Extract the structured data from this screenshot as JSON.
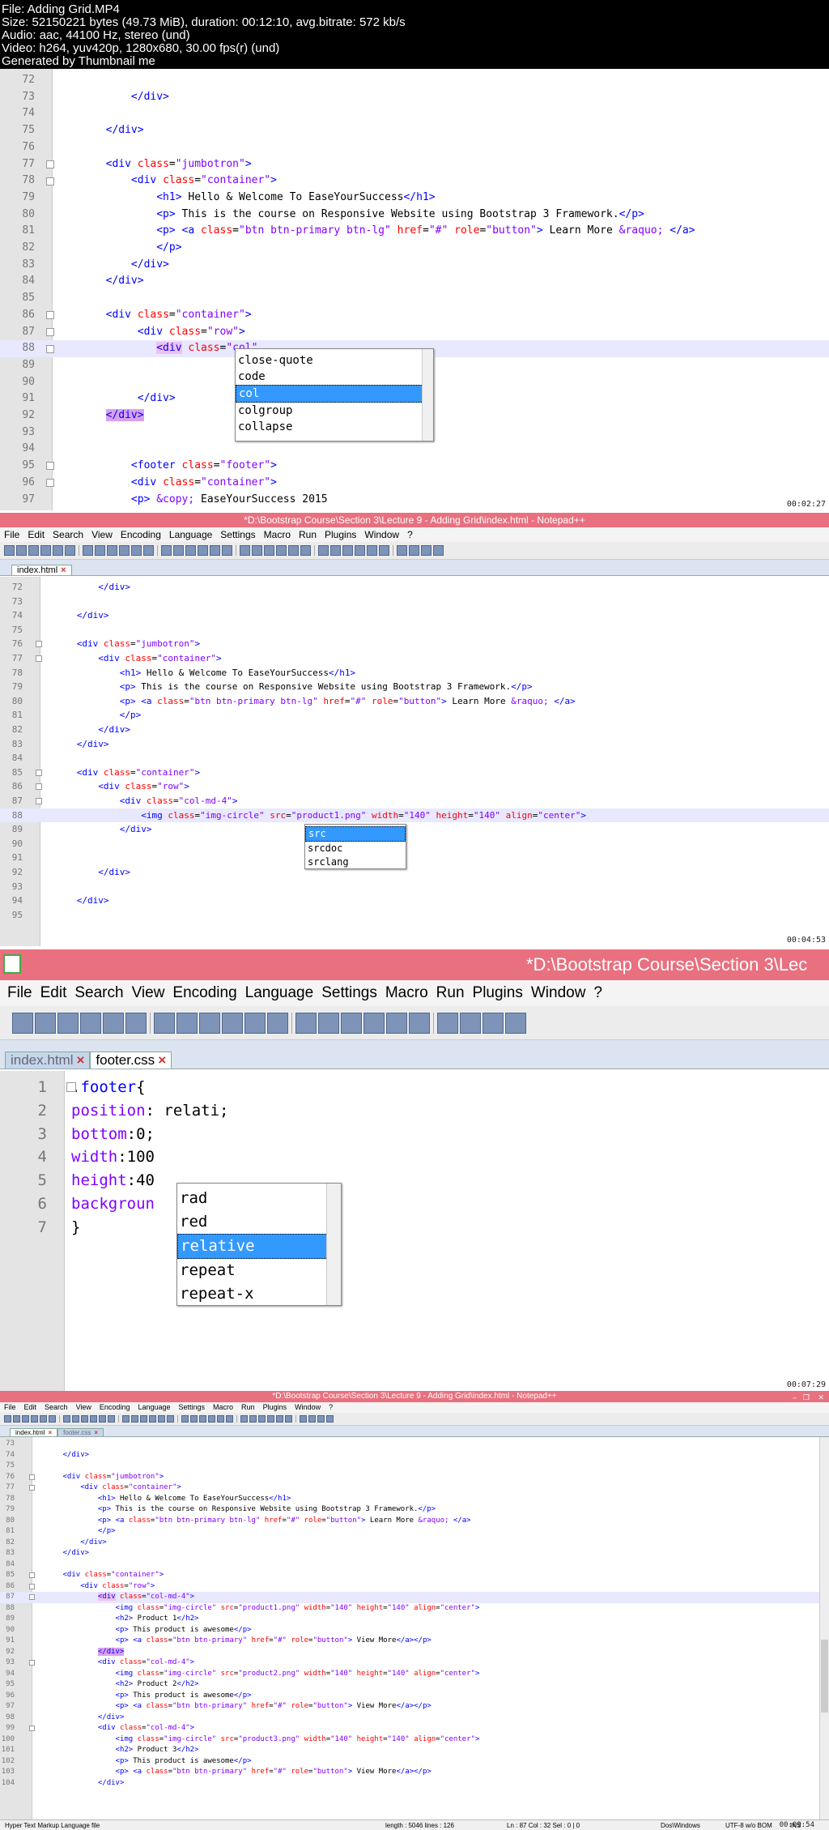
{
  "header": {
    "lines": [
      "File: Adding Grid.MP4",
      "Size: 52150221 bytes (49.73 MiB), duration: 00:12:10, avg.bitrate: 572 kb/s",
      "Audio: aac, 44100 Hz, stereo (und)",
      "Video: h264, yuv420p, 1280x680, 30.00 fps(r) (und)",
      "Generated by Thumbnail me"
    ]
  },
  "panel1": {
    "timestamp": "00:02:27",
    "lines": [
      {
        "n": "72",
        "html": ""
      },
      {
        "n": "73",
        "html": "            <span class='t'>&lt;/div&gt;</span>"
      },
      {
        "n": "74",
        "html": ""
      },
      {
        "n": "75",
        "html": "        <span class='t'>&lt;/div&gt;</span>"
      },
      {
        "n": "76",
        "html": ""
      },
      {
        "n": "77",
        "html": "        <span class='t'>&lt;div</span> <span class='a'>class</span>=<span class='v'>\"jumbotron\"</span><span class='t'>&gt;</span>"
      },
      {
        "n": "78",
        "html": "            <span class='t'>&lt;div</span> <span class='a'>class</span>=<span class='v'>\"container\"</span><span class='t'>&gt;</span>"
      },
      {
        "n": "79",
        "html": "                <span class='t'>&lt;h1&gt;</span> Hello &amp; Welcome To EaseYourSuccess<span class='t'>&lt;/h1&gt;</span>"
      },
      {
        "n": "80",
        "html": "                <span class='t'>&lt;p&gt;</span> This is the course on Responsive Website using Bootstrap 3 Framework.<span class='t'>&lt;/p&gt;</span>"
      },
      {
        "n": "81",
        "html": "                <span class='t'>&lt;p&gt;</span> <span class='t'>&lt;a</span> <span class='a'>class</span>=<span class='v'>\"btn btn-primary btn-lg\"</span> <span class='a'>href</span>=<span class='v'>\"#\"</span> <span class='a'>role</span>=<span class='v'>\"button\"</span><span class='t'>&gt;</span> Learn More <span class='v'>&amp;raquo;</span> <span class='t'>&lt;/a&gt;</span>"
      },
      {
        "n": "82",
        "html": "                <span class='t'>&lt;/p&gt;</span>"
      },
      {
        "n": "83",
        "html": "            <span class='t'>&lt;/div&gt;</span>"
      },
      {
        "n": "84",
        "html": "        <span class='t'>&lt;/div&gt;</span>"
      },
      {
        "n": "85",
        "html": ""
      },
      {
        "n": "86",
        "html": "        <span class='t'>&lt;div</span> <span class='a'>class</span>=<span class='v'>\"container\"</span><span class='t'>&gt;</span>"
      },
      {
        "n": "87",
        "html": "             <span class='t'>&lt;div</span> <span class='a'>class</span>=<span class='v'>\"row\"</span><span class='t'>&gt;</span>"
      },
      {
        "n": "88",
        "html": "                <span class='t' style='background:#f0c0f0'>&lt;div</span> <span class='a'>class</span>=<span class='v'>\"col\"</span>"
      },
      {
        "n": "89",
        "html": ""
      },
      {
        "n": "90",
        "html": ""
      },
      {
        "n": "91",
        "html": "             <span class='t'>&lt;/div&gt;</span>"
      },
      {
        "n": "92",
        "html": "        <span class='t' style='background:#d9a0f0'>&lt;/div&gt;</span>"
      },
      {
        "n": "93",
        "html": ""
      },
      {
        "n": "94",
        "html": ""
      },
      {
        "n": "95",
        "html": "            <span class='t'>&lt;footer</span> <span class='a'>class</span>=<span class='v'>\"footer\"</span><span class='t'>&gt;</span>"
      },
      {
        "n": "96",
        "html": "            <span class='t'>&lt;div</span> <span class='a'>class</span>=<span class='v'>\"container\"</span><span class='t'>&gt;</span>"
      },
      {
        "n": "97",
        "html": "            <span class='t'>&lt;p&gt;</span> <span class='v'>&amp;copy;</span> EaseYourSuccess 2015"
      }
    ],
    "autocomplete": [
      "close-quote",
      "code",
      "col",
      "colgroup",
      "collapse"
    ],
    "selected": 2
  },
  "panel2": {
    "timestamp": "00:04:53",
    "title": "*D:\\Bootstrap Course\\Section 3\\Lecture 9 - Adding Grid\\index.html - Notepad++",
    "menu": [
      "File",
      "Edit",
      "Search",
      "View",
      "Encoding",
      "Language",
      "Settings",
      "Macro",
      "Run",
      "Plugins",
      "Window",
      "?"
    ],
    "tabs": [
      {
        "label": "index.html",
        "active": true
      }
    ],
    "lines": [
      {
        "n": "72",
        "html": "          <span class='t'>&lt;/div&gt;</span>"
      },
      {
        "n": "73",
        "html": ""
      },
      {
        "n": "74",
        "html": "      <span class='t'>&lt;/div&gt;</span>"
      },
      {
        "n": "75",
        "html": ""
      },
      {
        "n": "76",
        "html": "      <span class='t'>&lt;div</span> <span class='a'>class</span>=<span class='v'>\"jumbotron\"</span><span class='t'>&gt;</span>"
      },
      {
        "n": "77",
        "html": "          <span class='t'>&lt;div</span> <span class='a'>class</span>=<span class='v'>\"container\"</span><span class='t'>&gt;</span>"
      },
      {
        "n": "78",
        "html": "              <span class='t'>&lt;h1&gt;</span> Hello &amp; Welcome To EaseYourSuccess<span class='t'>&lt;/h1&gt;</span>"
      },
      {
        "n": "79",
        "html": "              <span class='t'>&lt;p&gt;</span> This is the course on Responsive Website using Bootstrap 3 Framework.<span class='t'>&lt;/p&gt;</span>"
      },
      {
        "n": "80",
        "html": "              <span class='t'>&lt;p&gt;</span> <span class='t'>&lt;a</span> <span class='a'>class</span>=<span class='v'>\"btn btn-primary btn-lg\"</span> <span class='a'>href</span>=<span class='v'>\"#\"</span> <span class='a'>role</span>=<span class='v'>\"button\"</span><span class='t'>&gt;</span> Learn More <span class='v'>&amp;raquo;</span> <span class='t'>&lt;/a&gt;</span>"
      },
      {
        "n": "81",
        "html": "              <span class='t'>&lt;/p&gt;</span>"
      },
      {
        "n": "82",
        "html": "          <span class='t'>&lt;/div&gt;</span>"
      },
      {
        "n": "83",
        "html": "      <span class='t'>&lt;/div&gt;</span>"
      },
      {
        "n": "84",
        "html": ""
      },
      {
        "n": "85",
        "html": "      <span class='t'>&lt;div</span> <span class='a'>class</span>=<span class='v'>\"container\"</span><span class='t'>&gt;</span>"
      },
      {
        "n": "86",
        "html": "          <span class='t'>&lt;div</span> <span class='a'>class</span>=<span class='v'>\"row\"</span><span class='t'>&gt;</span>"
      },
      {
        "n": "87",
        "html": "              <span class='t'>&lt;div</span> <span class='a'>class</span>=<span class='v'>\"col-md-4\"</span><span class='t'>&gt;</span>"
      },
      {
        "n": "88",
        "html": "                  <span class='t'>&lt;img</span> <span class='a'>class</span>=<span class='v'>\"img-circle\"</span> <span class='a'>src</span>=<span class='v'>\"product1.png\"</span> <span class='a'>width</span>=<span class='v'>\"140\"</span> <span class='a'>height</span>=<span class='v'>\"140\"</span> <span class='a'>align</span>=<span class='v'>\"center\"</span><span class='t'>&gt;</span>"
      },
      {
        "n": "89",
        "html": "              <span class='t'>&lt;/div&gt;</span>"
      },
      {
        "n": "90",
        "html": ""
      },
      {
        "n": "91",
        "html": ""
      },
      {
        "n": "92",
        "html": "          <span class='t'>&lt;/div&gt;</span>"
      },
      {
        "n": "93",
        "html": ""
      },
      {
        "n": "94",
        "html": "      <span class='t'>&lt;/div&gt;</span>"
      },
      {
        "n": "95",
        "html": ""
      }
    ],
    "autocomplete": [
      "src",
      "srcdoc",
      "srclang"
    ],
    "selected": 0
  },
  "panel3": {
    "timestamp": "00:07:29",
    "title": "*D:\\Bootstrap Course\\Section 3\\Lec",
    "menu": [
      "File",
      "Edit",
      "Search",
      "View",
      "Encoding",
      "Language",
      "Settings",
      "Macro",
      "Run",
      "Plugins",
      "Window",
      "?"
    ],
    "tabs": [
      {
        "label": "index.html",
        "active": false
      },
      {
        "label": "footer.css",
        "active": true
      }
    ],
    "lines": [
      {
        "n": "1",
        "html": ".<span class='t'>footer</span>{"
      },
      {
        "n": "2",
        "html": "<span class='v'>position</span>: relati;"
      },
      {
        "n": "3",
        "html": "<span class='v'>bottom</span>:0;"
      },
      {
        "n": "4",
        "html": "<span class='v'>width</span>:100"
      },
      {
        "n": "5",
        "html": "<span class='v'>height</span>:40"
      },
      {
        "n": "6",
        "html": "<span class='v'>backgroun</span>"
      },
      {
        "n": "7",
        "html": "}"
      }
    ],
    "autocomplete": [
      "rad",
      "red",
      "relative",
      "repeat",
      "repeat-x"
    ],
    "selected": 2
  },
  "panel4": {
    "timestamp": "00:09:54",
    "title": "*D:\\Bootstrap Course\\Section 3\\Lecture 9 - Adding Grid\\index.html - Notepad++",
    "menu": [
      "File",
      "Edit",
      "Search",
      "View",
      "Encoding",
      "Language",
      "Settings",
      "Macro",
      "Run",
      "Plugins",
      "Window",
      "?"
    ],
    "tabs": [
      {
        "label": "index.html",
        "active": true
      },
      {
        "label": "footer.css",
        "active": false
      }
    ],
    "lines": [
      {
        "n": "73",
        "html": ""
      },
      {
        "n": "74",
        "html": "      <span class='t'>&lt;/div&gt;</span>"
      },
      {
        "n": "75",
        "html": ""
      },
      {
        "n": "76",
        "html": "      <span class='t'>&lt;div</span> <span class='a'>class</span>=<span class='v'>\"jumbotron\"</span><span class='t'>&gt;</span>"
      },
      {
        "n": "77",
        "html": "          <span class='t'>&lt;div</span> <span class='a'>class</span>=<span class='v'>\"container\"</span><span class='t'>&gt;</span>"
      },
      {
        "n": "78",
        "html": "              <span class='t'>&lt;h1&gt;</span> Hello &amp; Welcome To EaseYourSuccess<span class='t'>&lt;/h1&gt;</span>"
      },
      {
        "n": "79",
        "html": "              <span class='t'>&lt;p&gt;</span> This is the course on Responsive Website using Bootstrap 3 Framework.<span class='t'>&lt;/p&gt;</span>"
      },
      {
        "n": "80",
        "html": "              <span class='t'>&lt;p&gt;</span> <span class='t'>&lt;a</span> <span class='a'>class</span>=<span class='v'>\"btn btn-primary btn-lg\"</span> <span class='a'>href</span>=<span class='v'>\"#\"</span> <span class='a'>role</span>=<span class='v'>\"button\"</span><span class='t'>&gt;</span> Learn More <span class='v'>&amp;raquo;</span> <span class='t'>&lt;/a&gt;</span>"
      },
      {
        "n": "81",
        "html": "              <span class='t'>&lt;/p&gt;</span>"
      },
      {
        "n": "82",
        "html": "          <span class='t'>&lt;/div&gt;</span>"
      },
      {
        "n": "83",
        "html": "      <span class='t'>&lt;/div&gt;</span>"
      },
      {
        "n": "84",
        "html": ""
      },
      {
        "n": "85",
        "html": "      <span class='t'>&lt;div</span> <span class='a'>class</span>=<span class='v'>\"container\"</span><span class='t'>&gt;</span>"
      },
      {
        "n": "86",
        "html": "          <span class='t'>&lt;div</span> <span class='a'>class</span>=<span class='v'>\"row\"</span><span class='t'>&gt;</span>"
      },
      {
        "n": "87",
        "html": "              <span class='t' style='background:#f0c0f0'>&lt;div</span> <span class='a'>class</span>=<span class='v'>\"col-md-4\"</span><span class='t'>&gt;</span>"
      },
      {
        "n": "88",
        "html": "                  <span class='t'>&lt;img</span> <span class='a'>class</span>=<span class='v'>\"img-circle\"</span> <span class='a'>src</span>=<span class='v'>\"product1.png\"</span> <span class='a'>width</span>=<span class='v'>\"140\"</span> <span class='a'>height</span>=<span class='v'>\"140\"</span> <span class='a'>align</span>=<span class='v'>\"center\"</span><span class='t'>&gt;</span>"
      },
      {
        "n": "89",
        "html": "                  <span class='t'>&lt;h2&gt;</span> Product 1<span class='t'>&lt;/h2&gt;</span>"
      },
      {
        "n": "90",
        "html": "                  <span class='t'>&lt;p&gt;</span> This product is awesome<span class='t'>&lt;/p&gt;</span>"
      },
      {
        "n": "91",
        "html": "                  <span class='t'>&lt;p&gt;</span> <span class='t'>&lt;a</span> <span class='a'>class</span>=<span class='v'>\"btn btn-primary\"</span> <span class='a'>href</span>=<span class='v'>\"#\"</span> <span class='a'>role</span>=<span class='v'>\"button\"</span><span class='t'>&gt;</span> View More<span class='t'>&lt;/a&gt;&lt;/p&gt;</span>"
      },
      {
        "n": "92",
        "html": "              <span class='t' style='background:#d9a0f0'>&lt;/div&gt;</span>"
      },
      {
        "n": "93",
        "html": "              <span class='t'>&lt;div</span> <span class='a'>class</span>=<span class='v'>\"col-md-4\"</span><span class='t'>&gt;</span>"
      },
      {
        "n": "94",
        "html": "                  <span class='t'>&lt;img</span> <span class='a'>class</span>=<span class='v'>\"img-circle\"</span> <span class='a'>src</span>=<span class='v'>\"product2.png\"</span> <span class='a'>width</span>=<span class='v'>\"140\"</span> <span class='a'>height</span>=<span class='v'>\"140\"</span> <span class='a'>align</span>=<span class='v'>\"center\"</span><span class='t'>&gt;</span>"
      },
      {
        "n": "95",
        "html": "                  <span class='t'>&lt;h2&gt;</span> Product 2<span class='t'>&lt;/h2&gt;</span>"
      },
      {
        "n": "96",
        "html": "                  <span class='t'>&lt;p&gt;</span> This product is awesome<span class='t'>&lt;/p&gt;</span>"
      },
      {
        "n": "97",
        "html": "                  <span class='t'>&lt;p&gt;</span> <span class='t'>&lt;a</span> <span class='a'>class</span>=<span class='v'>\"btn btn-primary\"</span> <span class='a'>href</span>=<span class='v'>\"#\"</span> <span class='a'>role</span>=<span class='v'>\"button\"</span><span class='t'>&gt;</span> View More<span class='t'>&lt;/a&gt;&lt;/p&gt;</span>"
      },
      {
        "n": "98",
        "html": "              <span class='t'>&lt;/div&gt;</span>"
      },
      {
        "n": "99",
        "html": "              <span class='t'>&lt;div</span> <span class='a'>class</span>=<span class='v'>\"col-md-4\"</span><span class='t'>&gt;</span>"
      },
      {
        "n": "100",
        "html": "                  <span class='t'>&lt;img</span> <span class='a'>class</span>=<span class='v'>\"img-circle\"</span> <span class='a'>src</span>=<span class='v'>\"product3.png\"</span> <span class='a'>width</span>=<span class='v'>\"140\"</span> <span class='a'>height</span>=<span class='v'>\"140\"</span> <span class='a'>align</span>=<span class='v'>\"center\"</span><span class='t'>&gt;</span>"
      },
      {
        "n": "101",
        "html": "                  <span class='t'>&lt;h2&gt;</span> Product 3<span class='t'>&lt;/h2&gt;</span>"
      },
      {
        "n": "102",
        "html": "                  <span class='t'>&lt;p&gt;</span> This product is awesome<span class='t'>&lt;/p&gt;</span>"
      },
      {
        "n": "103",
        "html": "                  <span class='t'>&lt;p&gt;</span> <span class='t'>&lt;a</span> <span class='a'>class</span>=<span class='v'>\"btn btn-primary\"</span> <span class='a'>href</span>=<span class='v'>\"#\"</span> <span class='a'>role</span>=<span class='v'>\"button\"</span><span class='t'>&gt;</span> View More<span class='t'>&lt;/a&gt;&lt;/p&gt;</span>"
      },
      {
        "n": "104",
        "html": "              <span class='t'>&lt;/div&gt;</span>"
      }
    ],
    "status": {
      "lang": "Hyper Text Markup Language file",
      "length": "length : 5046    lines : 126",
      "pos": "Ln : 87    Col : 32    Sel : 0 | 0",
      "eol": "Dos\\Windows",
      "enc": "UTF-8 w/o BOM",
      "mode": "INS"
    }
  }
}
